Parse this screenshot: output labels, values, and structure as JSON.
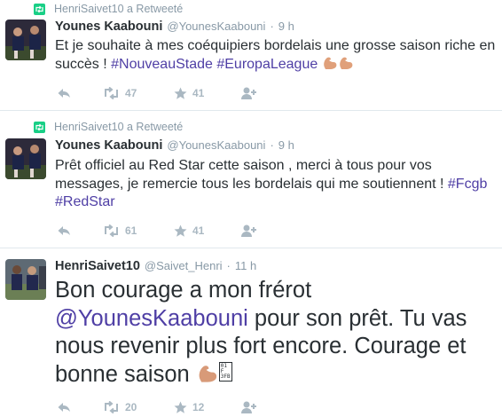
{
  "tweets": [
    {
      "retweet_notice": "HenriSaivet10 a Retweeté",
      "name": "Younes Kaabouni",
      "handle": "@YounesKaabouni",
      "time": "9 h",
      "text_plain": "Et je souhaite à mes coéquipiers bordelais une grosse saison riche en succès ! ",
      "hashtags": [
        "#NouveauStade",
        "#EuropaLeague"
      ],
      "retweets": "47",
      "likes": "41"
    },
    {
      "retweet_notice": "HenriSaivet10 a Retweeté",
      "name": "Younes Kaabouni",
      "handle": "@YounesKaabouni",
      "time": "9 h",
      "text_plain": "Prêt officiel au Red Star cette saison , merci à tous pour vos messages, je remercie tous les bordelais qui me soutiennent ! ",
      "hashtags": [
        "#Fcgb",
        "#RedStar"
      ],
      "retweets": "61",
      "likes": "41"
    },
    {
      "name": "HenriSaivet10",
      "handle": "@Saivet_Henri",
      "time": "11 h",
      "text_before": "Bon courage a mon frérot ",
      "mention": "@YounesKaabouni",
      "text_after": " pour son prêt. Tu vas nous revenir plus fort encore. Courage et bonne saison ",
      "retweets": "20",
      "likes": "12"
    }
  ],
  "colors": {
    "link": "#4f3fa5",
    "muted": "#8899a6",
    "icon": "#aab8c2",
    "retweet_badge": "#19cf86"
  },
  "icons": [
    "retweet-badge-icon",
    "reply-icon",
    "retweet-icon",
    "like-icon",
    "follow-icon",
    "flexed-biceps-emoji"
  ]
}
